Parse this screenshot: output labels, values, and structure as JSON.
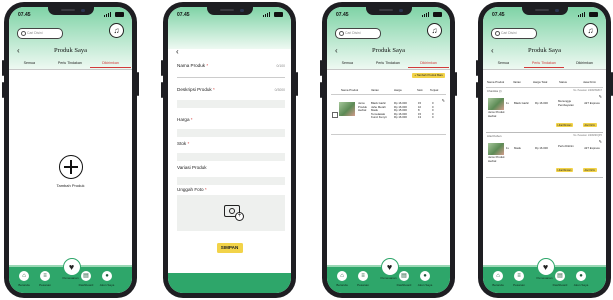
{
  "status_time": "07.45",
  "search_placeholder": "Cari Disini",
  "page_title": "Produk Saya",
  "tabs": [
    "Semua",
    "Perlu Tindakan",
    "Dikirimkan"
  ],
  "add_product_label": "Tambah Produk",
  "nav": [
    "Beranda",
    "Pesanan",
    "Pencari",
    "Dashboard",
    "Akun Saya"
  ],
  "nav_center_label": "Pemesanan",
  "form": {
    "name_label": "Nama Produk",
    "name_count": "0/100",
    "desc_label": "Deskripsi Produk",
    "desc_count": "0/3000",
    "price_label": "Harga",
    "stock_label": "Stok",
    "variant_label": "Variasi Produk",
    "photo_label": "Unggah Foto",
    "save_label": "SIMPAN",
    "required_mark": "*"
  },
  "list": {
    "add_button": "+ Tambah Produk Baru",
    "headers": [
      "Nama Produk",
      "Varian",
      "Harga",
      "Stok",
      "Terjual"
    ],
    "product_name": "Jamu Produk Herbal",
    "variants": [
      "Black Garlic",
      "Jahe Merah",
      "Madu",
      "Temulawak",
      "Kunci Kunyit"
    ],
    "prices": [
      "Rp 16.000",
      "Rp 16.000",
      "Rp 15.000",
      "Rp 16.000",
      "Rp 16.000"
    ],
    "stocks": [
      "15",
      "10",
      "8",
      "15",
      "13"
    ],
    "sold": [
      "0",
      "0",
      "0",
      "0",
      "0"
    ]
  },
  "orders": {
    "headers": [
      "Nama Produk",
      "Varian",
      "Harga Total",
      "Status",
      "Jasa Kirim"
    ],
    "cards": [
      {
        "buyer": "Chantika (r)",
        "customer_name": "No. Pesanan: 240329W8C7",
        "product": "Jamu Produk Herbal",
        "qty": "1x",
        "variant": "Black Garlic",
        "price": "Rp 16.000",
        "status": "Menunggu Pembayaran",
        "courier": "J&T Express",
        "btn1": "Lihat Rincian",
        "btn2": "Atur Kirim"
      },
      {
        "buyer": "Ariel Kohen",
        "customer_name": "No. Pesanan: 240329KQPX",
        "product": "Jamu Produk Herbal",
        "qty": "1x",
        "variant": "Madu",
        "price": "Rp 16.000",
        "status": "Perlu Dikirim",
        "courier": "J&T Express",
        "btn1": "Lihat Rincian",
        "btn2": "Atur Kirim"
      }
    ]
  },
  "colors": {
    "accent_green": "#2ea66a",
    "header_green": "#7fd3a6",
    "active_tab_red": "#d23b3b",
    "button_yellow": "#f2d349"
  }
}
